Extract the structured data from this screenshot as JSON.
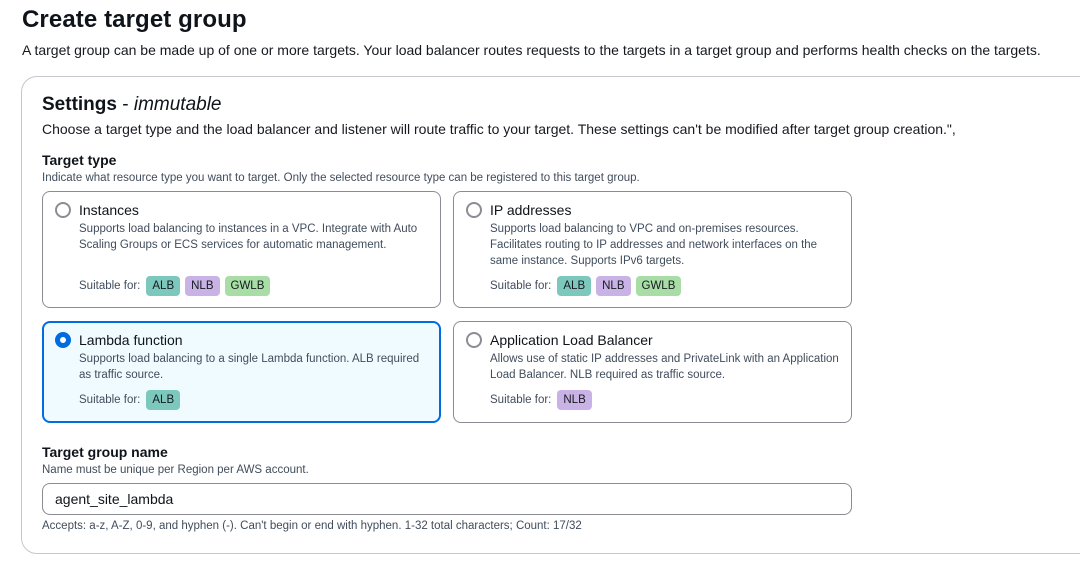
{
  "page": {
    "title": "Create target group",
    "description": "A target group can be made up of one or more targets. Your load balancer routes requests to the targets in a target group and performs health checks on the targets."
  },
  "settings": {
    "title": "Settings",
    "title_suffix": "immutable",
    "title_separator": " - ",
    "description": "Choose a target type and the load balancer and listener will route traffic to your target. These settings can't be modified after target group creation.\","
  },
  "target_type": {
    "label": "Target type",
    "hint": "Indicate what resource type you want to target. Only the selected resource type can be registered to this target group.",
    "suitable_label": "Suitable for:",
    "selected": "Lambda function",
    "options": [
      {
        "title": "Instances",
        "description": "Supports load balancing to instances in a VPC. Integrate with Auto Scaling Groups or ECS services for automatic management.",
        "badges": [
          "ALB",
          "NLB",
          "GWLB"
        ]
      },
      {
        "title": "IP addresses",
        "description": "Supports load balancing to VPC and on-premises resources. Facilitates routing to IP addresses and network interfaces on the same instance. Supports IPv6 targets.",
        "badges": [
          "ALB",
          "NLB",
          "GWLB"
        ]
      },
      {
        "title": "Lambda function",
        "description": "Supports load balancing to a single Lambda function. ALB required as traffic source.",
        "badges": [
          "ALB"
        ]
      },
      {
        "title": "Application Load Balancer",
        "description": "Allows use of static IP addresses and PrivateLink with an Application Load Balancer. NLB required as traffic source.",
        "badges": [
          "NLB"
        ]
      }
    ]
  },
  "target_group_name": {
    "label": "Target group name",
    "hint": "Name must be unique per Region per AWS account.",
    "value": "agent_site_lambda",
    "constraint": "Accepts: a-z, A-Z, 0-9, and hyphen (-). Can't begin or end with hyphen. 1-32 total characters; Count: 17/32"
  },
  "colors": {
    "selected_border": "#006ce0",
    "selected_background": "#f0fbff",
    "badge_alb": "#7cc8bd",
    "badge_nlb": "#c9b3e6",
    "badge_gwlb": "#a8dea6"
  }
}
